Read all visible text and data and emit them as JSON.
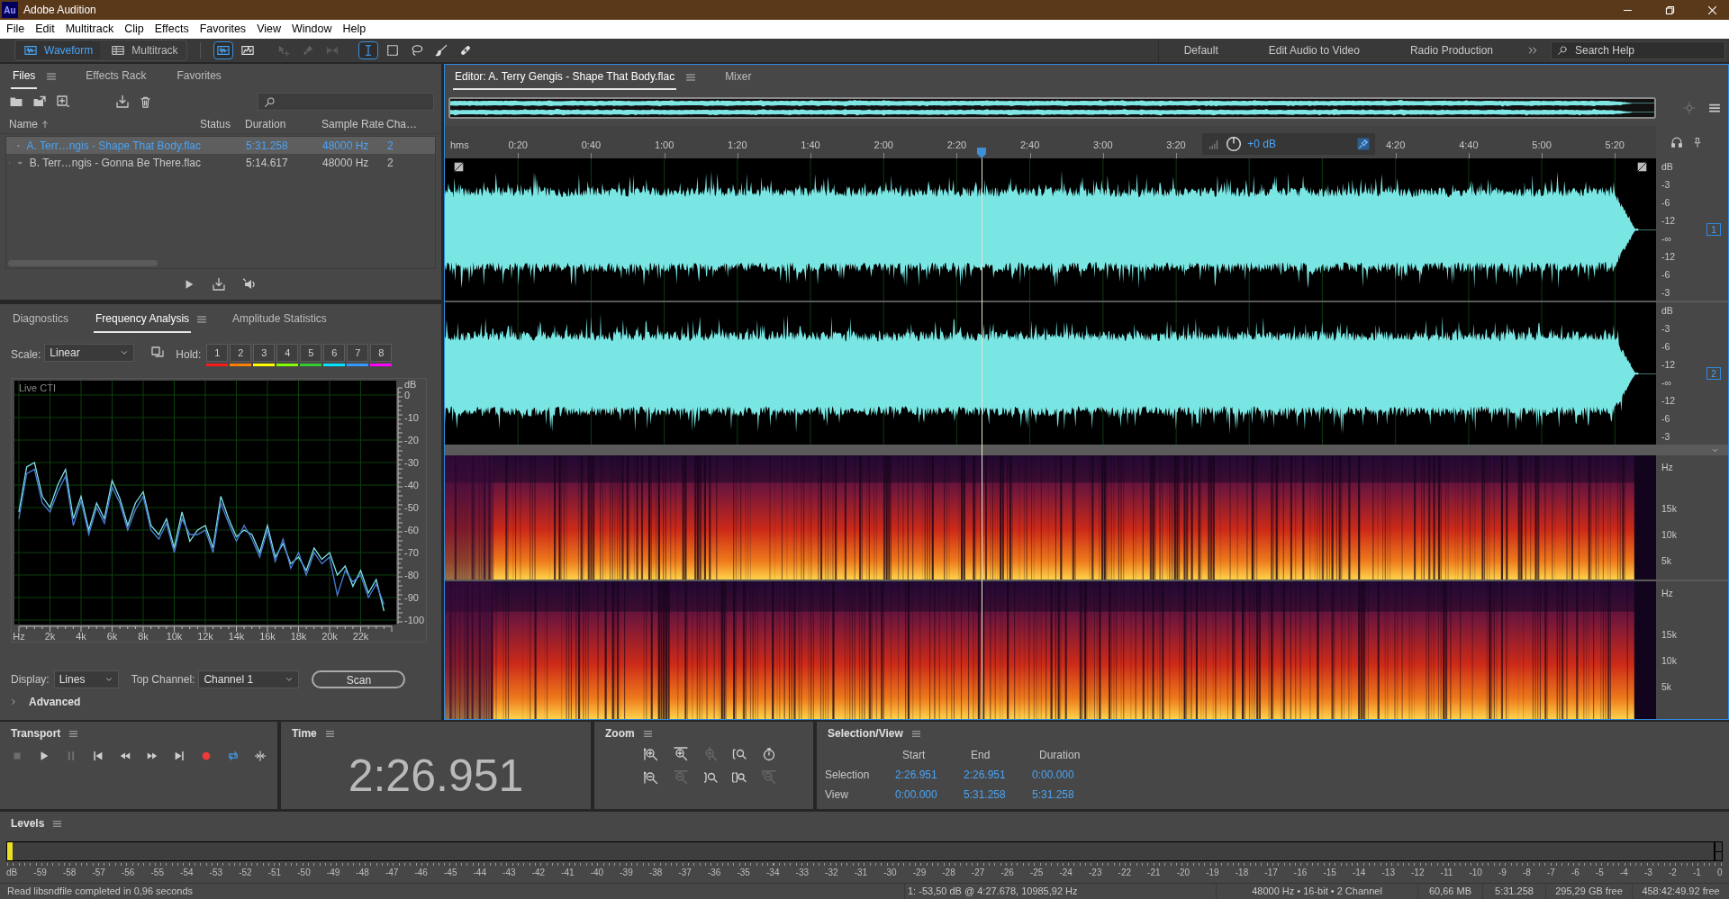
{
  "window": {
    "app_badge": "Au",
    "title": "Adobe Audition"
  },
  "menu": [
    "File",
    "Edit",
    "Multitrack",
    "Clip",
    "Effects",
    "Favorites",
    "View",
    "Window",
    "Help"
  ],
  "toolbar": {
    "view_modes": [
      {
        "label": "Waveform",
        "selected": true
      },
      {
        "label": "Multitrack",
        "selected": false
      }
    ],
    "tools": [
      {
        "kind": "waveform-display",
        "selected": true,
        "disabled": false
      },
      {
        "kind": "spectral-display",
        "selected": false,
        "disabled": false
      },
      {
        "kind": "move",
        "selected": false,
        "disabled": true
      },
      {
        "kind": "razor",
        "selected": false,
        "disabled": true
      },
      {
        "kind": "slip",
        "selected": false,
        "disabled": true
      },
      {
        "kind": "time-selection",
        "selected": true,
        "disabled": false
      },
      {
        "kind": "marquee",
        "selected": false,
        "disabled": false
      },
      {
        "kind": "lasso",
        "selected": false,
        "disabled": false
      },
      {
        "kind": "brush",
        "selected": false,
        "disabled": false
      },
      {
        "kind": "healing",
        "selected": false,
        "disabled": false
      }
    ],
    "workspaces": [
      "Default",
      "Edit Audio to Video",
      "Radio Production"
    ],
    "search": {
      "placeholder": "Search Help"
    }
  },
  "files_panel": {
    "tabs": [
      {
        "label": "Files",
        "selected": true
      },
      {
        "label": "Effects Rack",
        "selected": false
      },
      {
        "label": "Favorites",
        "selected": false
      }
    ],
    "columns": [
      "Name",
      "Status",
      "Duration",
      "Sample Rate",
      "Cha…"
    ],
    "rows": [
      {
        "name": "A. Terr…ngis - Shape That Body.flac",
        "duration": "5:31.258",
        "sample_rate": "48000 Hz",
        "channels": "2",
        "selected": true
      },
      {
        "name": "B. Terr…ngis - Gonna Be There.flac",
        "duration": "5:14.617",
        "sample_rate": "48000 Hz",
        "channels": "2",
        "selected": false
      }
    ]
  },
  "analysis_panel": {
    "tabs": [
      {
        "label": "Diagnostics",
        "selected": false
      },
      {
        "label": "Frequency Analysis",
        "selected": true
      },
      {
        "label": "Amplitude Statistics",
        "selected": false
      }
    ],
    "scale": {
      "label": "Scale:",
      "value": "Linear"
    },
    "hold_label": "Hold:",
    "holds": [
      {
        "label": "1",
        "color": "#ff1a1a"
      },
      {
        "label": "2",
        "color": "#ff8000"
      },
      {
        "label": "3",
        "color": "#ffff00"
      },
      {
        "label": "4",
        "color": "#80ff00"
      },
      {
        "label": "5",
        "color": "#33cc33"
      },
      {
        "label": "6",
        "color": "#00e5ff"
      },
      {
        "label": "7",
        "color": "#3399ff"
      },
      {
        "label": "8",
        "color": "#ff00ff"
      }
    ],
    "chart_caption": "Live CTI",
    "chart_data": {
      "type": "line",
      "ylabel": "dB",
      "grid": true,
      "xlim": [
        0,
        24000
      ],
      "ylim": [
        -100,
        0
      ],
      "xticks": [
        {
          "value": 0,
          "label": "Hz"
        },
        {
          "value": 2000,
          "label": "2k"
        },
        {
          "value": 4000,
          "label": "4k"
        },
        {
          "value": 6000,
          "label": "6k"
        },
        {
          "value": 8000,
          "label": "8k"
        },
        {
          "value": 10000,
          "label": "10k"
        },
        {
          "value": 12000,
          "label": "12k"
        },
        {
          "value": 14000,
          "label": "14k"
        },
        {
          "value": 16000,
          "label": "16k"
        },
        {
          "value": 18000,
          "label": "18k"
        },
        {
          "value": 20000,
          "label": "20k"
        },
        {
          "value": 22000,
          "label": "22k"
        }
      ],
      "yticks": [
        0,
        -10,
        -20,
        -30,
        -40,
        -50,
        -60,
        -70,
        -80,
        -90,
        -100
      ],
      "x": [
        0,
        500,
        1000,
        1500,
        2000,
        2500,
        3000,
        3500,
        4000,
        4500,
        5000,
        5500,
        6000,
        6500,
        7000,
        7500,
        8000,
        8500,
        9000,
        9500,
        10000,
        10500,
        11000,
        11500,
        12000,
        12500,
        13000,
        13500,
        14000,
        14500,
        15000,
        15500,
        16000,
        16500,
        17000,
        17500,
        18000,
        18500,
        19000,
        19500,
        20000,
        20500,
        21000,
        21500,
        22000,
        22500,
        23000,
        23500
      ],
      "series": [
        {
          "color": "#7fe3e8",
          "values": [
            -52,
            -32,
            -30,
            -45,
            -50,
            -40,
            -33,
            -55,
            -45,
            -60,
            -48,
            -55,
            -38,
            -46,
            -58,
            -48,
            -43,
            -58,
            -62,
            -55,
            -68,
            -52,
            -65,
            -60,
            -58,
            -68,
            -45,
            -55,
            -63,
            -60,
            -62,
            -70,
            -58,
            -72,
            -66,
            -75,
            -72,
            -78,
            -68,
            -73,
            -70,
            -80,
            -76,
            -85,
            -78,
            -88,
            -82,
            -96
          ]
        },
        {
          "color": "#4a7fd8",
          "values": [
            -55,
            -35,
            -33,
            -48,
            -52,
            -43,
            -36,
            -58,
            -47,
            -62,
            -50,
            -57,
            -41,
            -48,
            -60,
            -51,
            -45,
            -60,
            -64,
            -57,
            -70,
            -55,
            -62,
            -62,
            -60,
            -70,
            -48,
            -57,
            -65,
            -58,
            -64,
            -72,
            -60,
            -74,
            -64,
            -77,
            -70,
            -80,
            -70,
            -75,
            -72,
            -89,
            -78,
            -83,
            -80,
            -90,
            -84,
            -93
          ]
        }
      ]
    },
    "display": {
      "label": "Display:",
      "value": "Lines"
    },
    "top_channel": {
      "label": "Top Channel:",
      "value": "Channel 1"
    },
    "scan_button": "Scan",
    "advanced": "Advanced"
  },
  "editor": {
    "tabs": [
      {
        "label": "Editor: A. Terry Gengis - Shape That Body.flac",
        "selected": true
      },
      {
        "label": "Mixer",
        "selected": false
      }
    ],
    "ruler": [
      {
        "kind": "unit",
        "label": "hms"
      },
      {
        "kind": "tick",
        "label": "0:20"
      },
      {
        "kind": "tick",
        "label": "0:40"
      },
      {
        "kind": "tick",
        "label": "1:00"
      },
      {
        "kind": "tick",
        "label": "1:20"
      },
      {
        "kind": "tick",
        "label": "1:40"
      },
      {
        "kind": "tick",
        "label": "2:00"
      },
      {
        "kind": "tick",
        "label": "2:20"
      },
      {
        "kind": "tick",
        "label": "2:40"
      },
      {
        "kind": "tick",
        "label": "3:00"
      },
      {
        "kind": "tick",
        "label": "3:20"
      },
      {
        "kind": "hud",
        "label": "+0 dB"
      },
      {
        "kind": "tick",
        "label": "4:20"
      },
      {
        "kind": "tick",
        "label": "4:40"
      },
      {
        "kind": "tick",
        "label": "5:00"
      },
      {
        "kind": "tick",
        "label": "5:20"
      }
    ],
    "playhead": {
      "level": 0.443
    },
    "waveform_channels": [
      {
        "badge": "1",
        "scale": [
          "dB",
          "-3",
          "-6",
          "-12",
          "-∞",
          "-12",
          "-6",
          "-3"
        ]
      },
      {
        "badge": "2",
        "scale": [
          "dB",
          "-3",
          "-6",
          "-12",
          "-∞",
          "-12",
          "-6",
          "-3"
        ]
      }
    ],
    "spectral_channels": [
      {
        "scale": [
          "Hz",
          "15k",
          "10k",
          "5k"
        ]
      },
      {
        "scale": [
          "Hz",
          "15k",
          "10k",
          "5k"
        ]
      }
    ]
  },
  "transport": {
    "title": "Transport",
    "buttons": [
      {
        "kind": "stop",
        "disabled": true,
        "on": false
      },
      {
        "kind": "play",
        "disabled": false,
        "on": false
      },
      {
        "kind": "pause",
        "disabled": true,
        "on": false
      },
      {
        "kind": "to-start",
        "disabled": false,
        "on": false
      },
      {
        "kind": "rewind",
        "disabled": false,
        "on": false
      },
      {
        "kind": "forward",
        "disabled": false,
        "on": false
      },
      {
        "kind": "to-end",
        "disabled": false,
        "on": false
      },
      {
        "kind": "record",
        "disabled": false,
        "on": false
      },
      {
        "kind": "loop",
        "disabled": false,
        "on": true
      },
      {
        "kind": "skip",
        "disabled": false,
        "on": false
      }
    ]
  },
  "time": {
    "title": "Time",
    "value": "2:26.951"
  },
  "zoom": {
    "title": "Zoom",
    "tools": [
      {
        "kind": "in-vertical",
        "disabled": false
      },
      {
        "kind": "in-horizontal",
        "disabled": false
      },
      {
        "kind": "in-point",
        "disabled": true
      },
      {
        "kind": "bracket-left",
        "disabled": false
      },
      {
        "kind": "stopwatch",
        "disabled": false
      },
      {
        "kind": "out-vertical",
        "disabled": false
      },
      {
        "kind": "out-horizontal",
        "disabled": true
      },
      {
        "kind": "bracket-right",
        "disabled": false
      },
      {
        "kind": "bracket-both",
        "disabled": false
      },
      {
        "kind": "out-full",
        "disabled": true
      }
    ]
  },
  "selection_view": {
    "title": "Selection/View",
    "columns": [
      "Start",
      "End",
      "Duration"
    ],
    "rows": [
      {
        "label": "Selection",
        "values": [
          "2:26.951",
          "2:26.951",
          "0:00.000"
        ]
      },
      {
        "label": "View",
        "values": [
          "0:00.000",
          "5:31.258",
          "5:31.258"
        ]
      }
    ]
  },
  "levels": {
    "title": "Levels",
    "meter": {
      "level": 0.003
    },
    "scale": [
      "dB",
      "-59",
      "-58",
      "-57",
      "-56",
      "-55",
      "-54",
      "-53",
      "-52",
      "-51",
      "-50",
      "-49",
      "-48",
      "-47",
      "-46",
      "-45",
      "-44",
      "-43",
      "-42",
      "-41",
      "-40",
      "-39",
      "-38",
      "-37",
      "-36",
      "-35",
      "-34",
      "-33",
      "-32",
      "-31",
      "-30",
      "-29",
      "-28",
      "-27",
      "-26",
      "-25",
      "-24",
      "-23",
      "-22",
      "-21",
      "-20",
      "-19",
      "-18",
      "-17",
      "-16",
      "-15",
      "-14",
      "-13",
      "-12",
      "-11",
      "-10",
      "-9",
      "-8",
      "-7",
      "-6",
      "-5",
      "-4",
      "-3",
      "-2",
      "-1",
      "0"
    ]
  },
  "status_bar": {
    "message": "Read libsndfile completed in 0,96 seconds",
    "fields": [
      "1: -53,50 dB @ 4:27.678, 10985,92 Hz",
      "48000 Hz • 16-bit • 2 Channel",
      "60,66 MB",
      "5:31.258",
      "295,29 GB free",
      "458:42:49.92 free"
    ]
  }
}
